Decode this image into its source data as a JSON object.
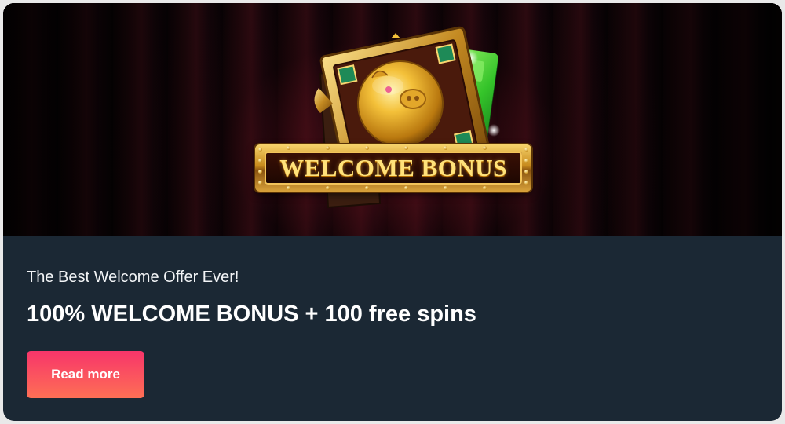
{
  "banner": {
    "title": "WELCOME BONUS"
  },
  "promo": {
    "subtitle": "The Best Welcome Offer Ever!",
    "headline": "100% WELCOME BONUS + 100 free spins",
    "button_label": "Read more"
  },
  "colors": {
    "card_background": "#1b2834",
    "button_gradient_start": "#f7356a",
    "button_gradient_end": "#fe6f55",
    "banner_accent": "#ffe27a"
  }
}
